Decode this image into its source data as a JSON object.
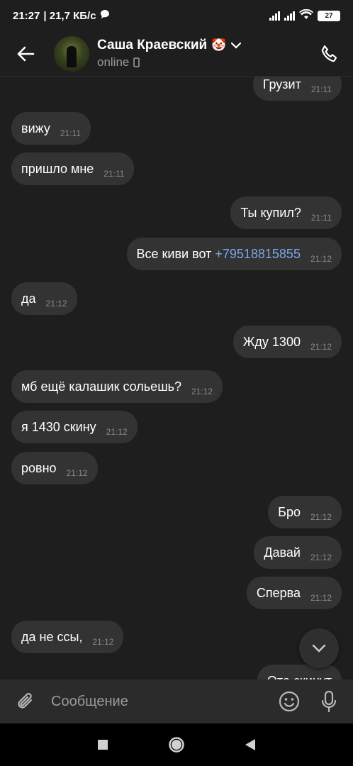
{
  "status_bar": {
    "time": "21:27",
    "speed": "| 21,7 КБ/с",
    "battery": "27"
  },
  "header": {
    "contact_name": "Саша Краевский",
    "contact_emoji": "🤡",
    "contact_status": "online"
  },
  "messages": [
    {
      "dir": "out",
      "text": "Грузит",
      "time": "21:11"
    },
    {
      "dir": "in",
      "text": "вижу",
      "time": "21:11"
    },
    {
      "dir": "in",
      "text": "пришло мне",
      "time": "21:11"
    },
    {
      "dir": "out",
      "text": "Ты купил?",
      "time": "21:11"
    },
    {
      "dir": "out",
      "text": "Все киви вот ",
      "link": "+79518815855",
      "time": "21:12"
    },
    {
      "dir": "in",
      "text": "да",
      "time": "21:12"
    },
    {
      "dir": "out",
      "text": "Жду 1300",
      "time": "21:12"
    },
    {
      "dir": "in",
      "text": "мб ещё калашик сольешь?",
      "time": "21:12"
    },
    {
      "dir": "in",
      "text": "я 1430 скину",
      "time": "21:12"
    },
    {
      "dir": "in",
      "text": "ровно",
      "time": "21:12"
    },
    {
      "dir": "out",
      "text": "Бро",
      "time": "21:12"
    },
    {
      "dir": "out",
      "text": "Давай",
      "time": "21:12"
    },
    {
      "dir": "out",
      "text": "Сперва",
      "time": "21:12"
    },
    {
      "dir": "in",
      "text": "да не ссы,",
      "time": "21:12"
    },
    {
      "dir": "out",
      "text": "Ото скинут",
      "time": ""
    }
  ],
  "composer": {
    "placeholder": "Сообщение"
  },
  "icons": {
    "back": "arrow-left-icon",
    "dropdown": "chevron-down-icon",
    "phone": "phone-icon",
    "device": "mobile-device-icon",
    "attach": "paperclip-icon",
    "emoji": "smiley-icon",
    "mic": "microphone-icon",
    "scroll": "chevron-down-icon"
  },
  "colors": {
    "background": "#1e1e1e",
    "bubble": "#333333",
    "link": "#7aa5e6",
    "composer": "#2b2b2b"
  }
}
